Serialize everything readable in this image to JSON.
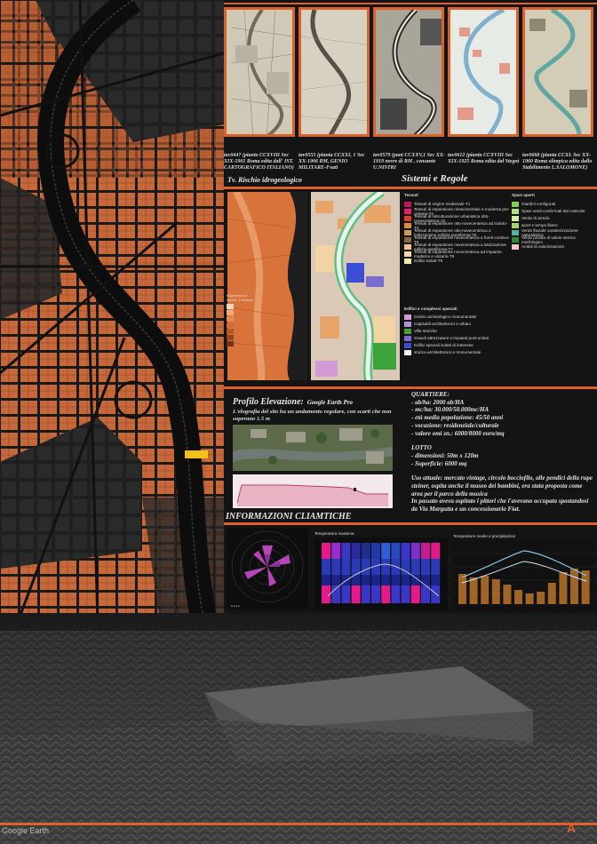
{
  "historical_maps": [
    {
      "caption": "tav0447 (pianta CCXVIII Sec XIX-1901 Roma edita dall' IST. CARTOGRAFICO ITALIANO)"
    },
    {
      "caption": "tav0555 (pianta CCXXI, 1 Sec XX-1906 RM, GENIO MILITARE-Foati"
    },
    {
      "caption": "tav0579 (pant CCXXV,1 Sec XX-1919 nevre di RM , censante U.NISTRI"
    },
    {
      "caption": "tav0612 (pianta CCXVIII Sec XIX-1925 Roma edita dal Stegni"
    },
    {
      "caption": "tav0668 (pianta CCXL Sec XX-1960 Roma olimpica edita dallo Stabilimento L.SALOMONE)"
    }
  ],
  "sections": {
    "hydro_title": "Tv. Rischio idrogeologico",
    "systems_title": "Sistemi e Regole",
    "hydro_legend_title": "Equidistanza isoline: 1 Bussini",
    "tessuti_title": "Tessuti",
    "spazi_title": "Spazi aperti",
    "edifici_title": "Edifici e complessi speciali",
    "profile_title": "Profilo Elevazione:",
    "profile_source": "Google Earth Pro",
    "profile_text": "L'elografia del sito ha un andamento regolare, con scarti che non superano 1.5 m",
    "climate_title": "INFORMAZIONI CLIAMTICHE",
    "temp_max_title": "Temperatura massima",
    "temp_prec_title": "Temperature medie e precipitazioni",
    "google_credit": "Google Earth",
    "logo": "A"
  },
  "tessuti_legend": [
    {
      "label": "Tessuti di origine medievale-T1",
      "color": "#c0175a"
    },
    {
      "label": "Tessuti di espansione rinascimentale e moderna pre-unitaria-T2",
      "color": "#e4206c"
    },
    {
      "label": "Tessuti di ristrutturazione urbanistica otto-novecentesca-13",
      "color": "#e23a2a"
    },
    {
      "label": "Tessuti di espansione otto-novecentesca ad isolato-T4",
      "color": "#e58a3a"
    },
    {
      "label": "Tessuti di espansione otto-novecentesca a lottizzazione edilizia puntiforme-T5",
      "color": "#c8a05a"
    },
    {
      "label": "Tessuti di espansione novecentesca a fronti continui-T6",
      "color": "#8c6a3e"
    },
    {
      "label": "Tessuti di espansione novecentesca a lottizzazione edilizia puntiforme-T7",
      "color": "#f1c48f"
    },
    {
      "label": "Tessuti di espansione novecentesca ad impianto moderno e unitario-T8",
      "color": "#f4d9a8"
    },
    {
      "label": "Edifici isolati-T9",
      "color": "#f5ee9a"
    }
  ],
  "edifici_legend": [
    {
      "label": "Centro archeologico monumentale",
      "color": "#d39ad6"
    },
    {
      "label": "Capisaldi architettonici e urbani",
      "color": "#b58fd3"
    },
    {
      "label": "Ville storiche",
      "color": "#3fa33c"
    },
    {
      "label": "Grandi attrezzature e impianti post-unitari",
      "color": "#7a6cd0"
    },
    {
      "label": "Edifici speciali isolati di interesse",
      "color": "#3b4fd4"
    },
    {
      "label": "storico-architettonico e monumentale",
      "color": "#e8f2f3"
    }
  ],
  "spazi_legend": [
    {
      "label": "Giardini configurati",
      "color": "#7fd15a"
    },
    {
      "label": "Spazi verdi conformati dal costruito",
      "color": "#b2e07a"
    },
    {
      "label": "Verde di arredo",
      "color": "#d6efa6"
    },
    {
      "label": "sport e tempo libero",
      "color": "#a4d46a"
    },
    {
      "label": "Verde fluviale caratterizzazione naturalistica",
      "color": "#4fb5a0"
    },
    {
      "label": "Verde privato di valore storico-morfologico",
      "color": "#2e8c2e"
    },
    {
      "label": "Ambiti di valorizzazione",
      "color": "#f3c8c8"
    }
  ],
  "quartiere": {
    "title": "QUARTIERE:",
    "lines": [
      "- ab/ha: 2000 ab/HA",
      "- mc/ha: 30.000/50.000mc/HA",
      "- età media popolazione: 45/50 anni",
      "- vocazione: residenziale/culturale",
      "- valore omi zn.: 6000/8000 euro/mq"
    ]
  },
  "lotto": {
    "title": "LOTTO",
    "lines": [
      "- dimensioni: 50m x 120m",
      "- Superficie: 6000 mq"
    ]
  },
  "uso_text": "Uso attuale: mercato vintage, circolo bocciofilo, alle pendici della rupe steiner, ospita anche il museo dei bambini, era stata proposta come area per il parco della musica",
  "passato_text": "In passato aveva ospitato i pittori che l'avevano occupata spostandosi da Via Margutta e un concessionario Fiat.",
  "colors": {
    "accent": "#e0612a",
    "bg": "#141414"
  }
}
